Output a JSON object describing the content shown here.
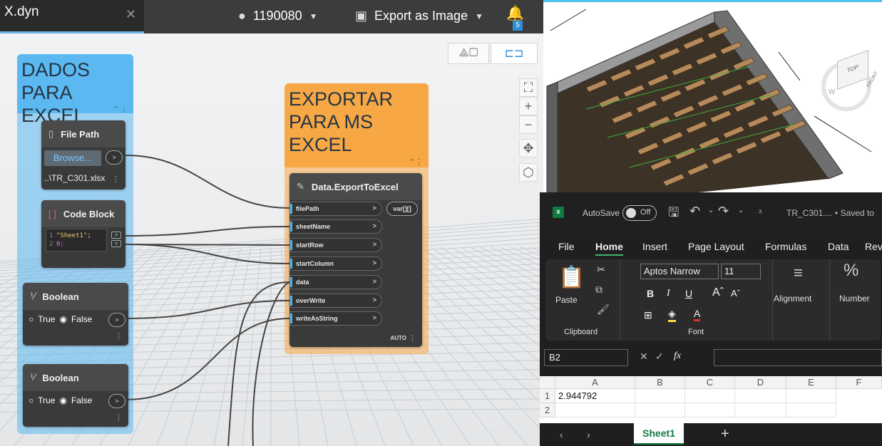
{
  "dynamo": {
    "file_tab": "X.dyn",
    "user": "1190080",
    "export_label": "Export as Image",
    "notification_count": "5",
    "groups": [
      {
        "title": "DADOS\nPARA EXCEL",
        "color": "#5bb8f0"
      },
      {
        "title": "EXPORTAR\nPARA MS\nEXCEL",
        "color": "#f7a845"
      }
    ],
    "filepath_node": {
      "title": "File Path",
      "browse": "Browse...",
      "value": "..\\TR_C301.xlsx"
    },
    "codeblock_node": {
      "title": "Code Block",
      "lines": [
        "\"Sheet1\";",
        "0;"
      ],
      "line_numbers": [
        "1",
        "2"
      ]
    },
    "boolean_nodes": [
      {
        "title": "Boolean",
        "true_label": "True",
        "false_label": "False",
        "selected": "False"
      },
      {
        "title": "Boolean",
        "true_label": "True",
        "false_label": "False",
        "selected": "False"
      }
    ],
    "export_node": {
      "title": "Data.ExportToExcel",
      "inputs": [
        "filePath",
        "sheetName",
        "startRow",
        "startColumn",
        "data",
        "overWrite",
        "writeAsString"
      ],
      "output": "var[][]",
      "lacing": "AUTO"
    }
  },
  "excel": {
    "autosave_label": "AutoSave",
    "autosave_state": "Off",
    "file_title": "TR_C301.... • Saved to",
    "menu": [
      "File",
      "Home",
      "Insert",
      "Page Layout",
      "Formulas",
      "Data",
      "Rev"
    ],
    "active_menu": "Home",
    "ribbon": {
      "paste": "Paste",
      "clipboard": "Clipboard",
      "font_name": "Aptos Narrow",
      "font_size": "11",
      "font_group": "Font",
      "alignment": "Alignment",
      "number": "Number",
      "bold": "B",
      "italic": "I",
      "underline": "U"
    },
    "name_box": "B2",
    "fx": "fx",
    "columns": [
      "A",
      "B",
      "C",
      "D",
      "E",
      "F"
    ],
    "rows": [
      "1",
      "2"
    ],
    "cells": {
      "A1": "2.944792"
    },
    "sheet_tab": "Sheet1",
    "add_sheet": "+"
  },
  "viewcube": {
    "top": "TOP",
    "front": "FRONT",
    "compass": "W"
  }
}
